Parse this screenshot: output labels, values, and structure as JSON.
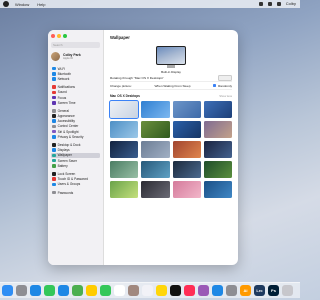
{
  "menubar": {
    "items": [
      "Window",
      "Help"
    ],
    "user": "Colby"
  },
  "window": {
    "sidebar": {
      "search_placeholder": "Search",
      "profile": {
        "name": "Colby Park",
        "subtitle": "Apple ID"
      },
      "groups": [
        [
          "Wi-Fi",
          "Bluetooth",
          "Network"
        ],
        [
          "Notifications",
          "Sound",
          "Focus",
          "Screen Time"
        ],
        [
          "General",
          "Appearance",
          "Accessibility",
          "Control Center",
          "Siri & Spotlight",
          "Privacy & Security"
        ],
        [
          "Desktop & Dock",
          "Displays",
          "Wallpaper",
          "Screen Saver",
          "Battery"
        ],
        [
          "Lock Screen",
          "Touch ID & Password",
          "Users & Groups"
        ],
        [
          "Passwords"
        ]
      ],
      "icon_colors": [
        [
          "#1e88e5",
          "#1e88e5",
          "#1e88e5"
        ],
        [
          "#e53935",
          "#e53935",
          "#5e35b1",
          "#5e35b1"
        ],
        [
          "#8e8e93",
          "#222222",
          "#1e88e5",
          "#8e8e93",
          "#7e57c2",
          "#1e88e5"
        ],
        [
          "#222222",
          "#1e88e5",
          "#26a69a",
          "#26a69a",
          "#43a047"
        ],
        [
          "#222222",
          "#e53935",
          "#1e88e5"
        ],
        [
          "#8e8e93"
        ]
      ]
    },
    "main": {
      "title": "Wallpaper",
      "display_label": "Built-in Display",
      "rotate_text": "Rotating through \"Mac OS X Desktops\"",
      "change_picture_label": "Change picture:",
      "change_picture_value": "When Waking From Sleep",
      "randomly_label": "Randomly",
      "section_title": "Mac OS X Desktops",
      "show_more": "Show less",
      "thumbs": [
        "linear-gradient(135deg,#eef1f6,#c9d3e2)",
        "linear-gradient(135deg,#2f7fd1,#7db8f0)",
        "linear-gradient(135deg,#6c95c9,#3e6aa8)",
        "linear-gradient(135deg,#3d6fb8,#1d3f78)",
        "linear-gradient(135deg,#4d8fc5,#9cc8e8)",
        "linear-gradient(135deg,#6b8f3c,#2f5a1e)",
        "linear-gradient(135deg,#2a5fa8,#163565)",
        "linear-gradient(135deg,#7f6b92,#c4a28a)",
        "linear-gradient(135deg,#12223f,#3a5e8f)",
        "linear-gradient(135deg,#6c7d95,#a1b0c4)",
        "linear-gradient(135deg,#a1452f,#e0864e)",
        "linear-gradient(135deg,#1a2340,#44628f)",
        "linear-gradient(135deg,#4b7d63,#98bfa5)",
        "linear-gradient(135deg,#27597a,#5fa1c4)",
        "linear-gradient(135deg,#1c2a3d,#4b6a8f)",
        "linear-gradient(135deg,#1f4d2a,#5a8f3e)",
        "linear-gradient(135deg,#6aa34a,#c4e07c)",
        "linear-gradient(135deg,#2b2b33,#6a6a75)",
        "linear-gradient(135deg,#d47a9b,#f2b6c9)",
        "linear-gradient(135deg,#1b4f86,#3f87c5)"
      ]
    }
  },
  "dock": {
    "apps": [
      {
        "name": "finder",
        "color": "#2f8ef4",
        "label": ""
      },
      {
        "name": "launchpad",
        "color": "#8e8e93",
        "label": ""
      },
      {
        "name": "safari",
        "color": "#1e88e5",
        "label": ""
      },
      {
        "name": "messages",
        "color": "#34c759",
        "label": ""
      },
      {
        "name": "mail",
        "color": "#1e88e5",
        "label": ""
      },
      {
        "name": "maps",
        "color": "#4caf50",
        "label": ""
      },
      {
        "name": "photos",
        "color": "#ffcc00",
        "label": ""
      },
      {
        "name": "facetime",
        "color": "#34c759",
        "label": ""
      },
      {
        "name": "calendar",
        "color": "#ffffff",
        "label": ""
      },
      {
        "name": "contacts",
        "color": "#a1887f",
        "label": ""
      },
      {
        "name": "reminders",
        "color": "#f2f2f7",
        "label": ""
      },
      {
        "name": "notes",
        "color": "#ffd60a",
        "label": ""
      },
      {
        "name": "tv",
        "color": "#111111",
        "label": ""
      },
      {
        "name": "music",
        "color": "#ff2d55",
        "label": ""
      },
      {
        "name": "podcasts",
        "color": "#9b59b6",
        "label": ""
      },
      {
        "name": "app-store",
        "color": "#1e88e5",
        "label": ""
      },
      {
        "name": "system-settings",
        "color": "#8e8e93",
        "label": ""
      },
      {
        "name": "ai",
        "color": "#ff9a00",
        "label": "Ai"
      },
      {
        "name": "lrc",
        "color": "#1e3a5f",
        "label": "Lrc"
      },
      {
        "name": "ps",
        "color": "#001e36",
        "label": "Ps"
      },
      {
        "name": "trash",
        "color": "#c7c7cc",
        "label": ""
      }
    ]
  }
}
